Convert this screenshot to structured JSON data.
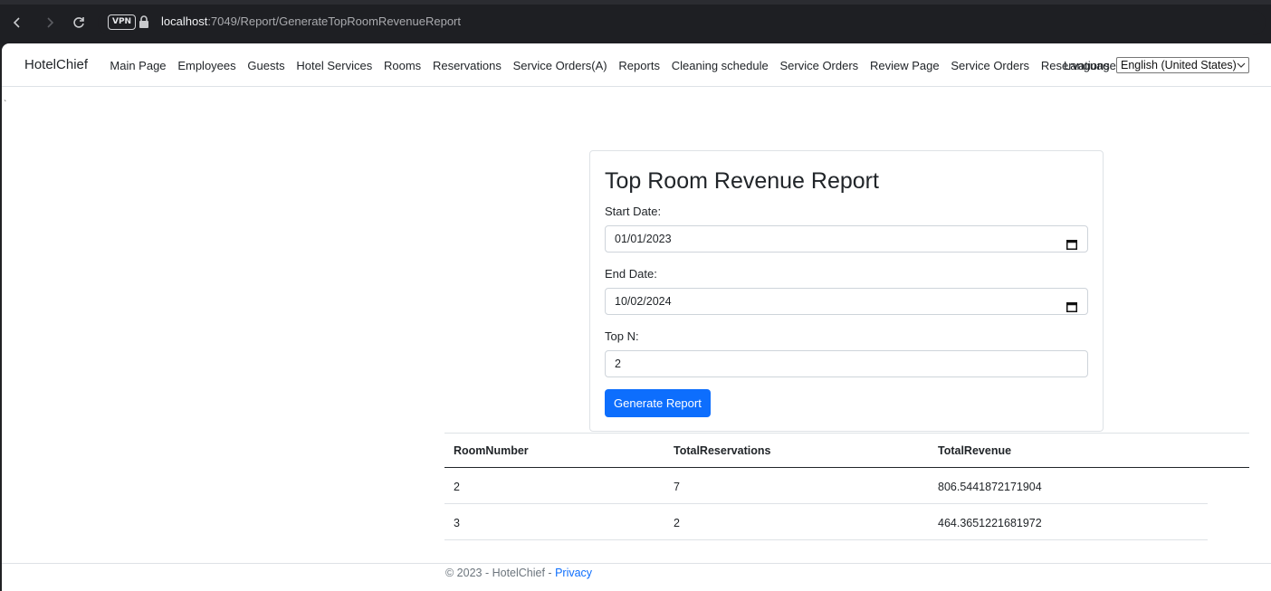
{
  "browser": {
    "url_host": "localhost",
    "url_path": ":7049/Report/GenerateTopRoomRevenueReport",
    "vpn_label": "VPN"
  },
  "nav": {
    "brand": "HotelChief",
    "links": [
      "Main Page",
      "Employees",
      "Guests",
      "Hotel Services",
      "Rooms",
      "Reservations",
      "Service Orders(A)",
      "Reports",
      "Cleaning schedule",
      "Service Orders",
      "Review Page",
      "Service Orders",
      "Reservations"
    ],
    "language_label": "Language",
    "language_selected": "English (United States)"
  },
  "stray_mark": "`",
  "form": {
    "title": "Top Room Revenue Report",
    "start_label": "Start Date:",
    "start_value": "01/01/2023",
    "end_label": "End Date:",
    "end_value": "10/02/2024",
    "topn_label": "Top N:",
    "topn_value": "2",
    "submit_label": "Generate Report"
  },
  "table": {
    "headers": [
      "RoomNumber",
      "TotalReservations",
      "TotalRevenue"
    ],
    "rows": [
      [
        "2",
        "7",
        "806.5441872171904"
      ],
      [
        "3",
        "2",
        "464.3651221681972"
      ]
    ]
  },
  "footer": {
    "text": "© 2023 - HotelChief - ",
    "privacy_link": "Privacy"
  },
  "colors": {
    "primary": "#0d6efd",
    "text": "#212529"
  }
}
